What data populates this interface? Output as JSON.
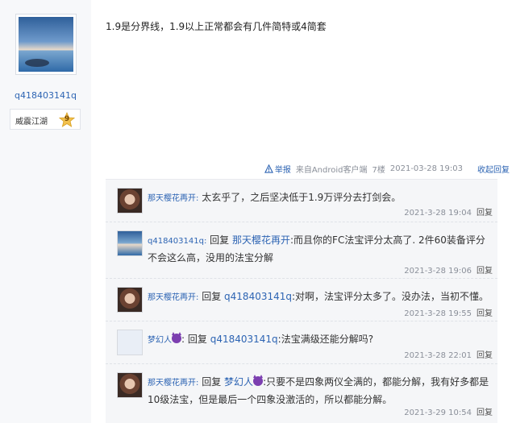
{
  "author": {
    "username": "q418403141q",
    "level_title": "威震江湖",
    "level_number": "9"
  },
  "post": {
    "text": "1.9是分界线，1.9以上正常都会有几件简特或4简套"
  },
  "tail": {
    "report_label": "举报",
    "client": "来自Android客户端",
    "floor": "7楼",
    "time": "2021-03-28 19:03",
    "collapse_label": "收起回复"
  },
  "replies": [
    {
      "name": "那天樱花再开:",
      "prefix": "",
      "target": "",
      "text": "太玄乎了，之后坚决低于1.9万评分去打剑会。",
      "time": "2021-3-28 19:04",
      "reply_label": "回复",
      "avatar": "woman-avatar"
    },
    {
      "name": "q418403141q:",
      "prefix": "回复",
      "target": "那天樱花再开",
      "text": ":而且你的FC法宝评分太高了. 2件60装备评分不会这么高，没用的法宝分解",
      "time": "2021-3-28 19:06",
      "reply_label": "回复",
      "avatar": "sea-avatar"
    },
    {
      "name": "那天樱花再开:",
      "prefix": "回复",
      "target": "q418403141q",
      "text": ":对啊，法宝评分太多了。没办法，当初不懂。",
      "time": "2021-3-28 19:55",
      "reply_label": "回复",
      "avatar": "woman-avatar"
    },
    {
      "name": "梦幻人",
      "prefix": "回复",
      "target": "q418403141q",
      "text": ":法宝满级还能分解吗?",
      "time": "2021-3-28 22:01",
      "reply_label": "回复",
      "avatar": "default-avatar"
    },
    {
      "name": "那天樱花再开:",
      "prefix": "回复",
      "target": "梦幻人",
      "text": ":只要不是四象两仪全满的，都能分解，我有好多都是10级法宝，但是最后一个四象没激活的，所以都能分解。",
      "time": "2021-3-29 10:54",
      "reply_label": "回复",
      "avatar": "woman-avatar"
    }
  ]
}
